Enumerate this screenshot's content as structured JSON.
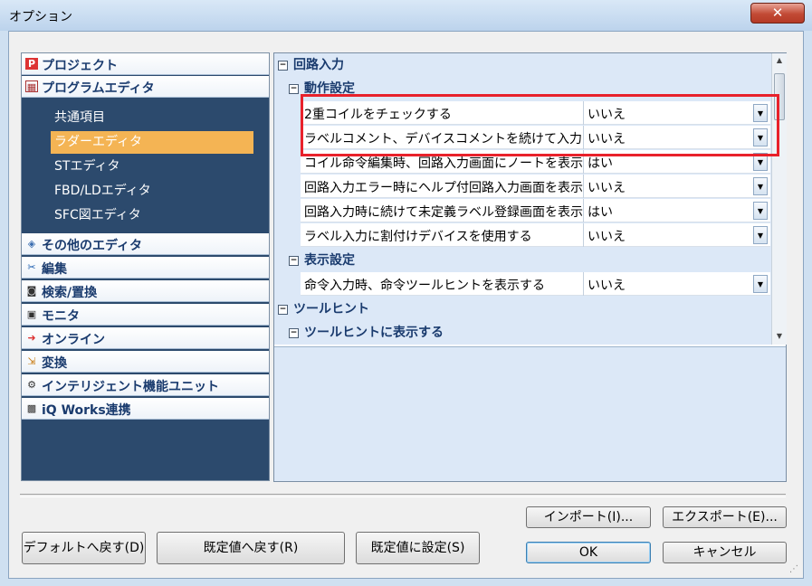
{
  "window": {
    "title": "オプション",
    "close": "✕"
  },
  "tree": {
    "categories_top": [
      {
        "label": "プロジェクト",
        "icon": "project-icon"
      },
      {
        "label": "プログラムエディタ",
        "icon": "program-editor-icon"
      }
    ],
    "sub_items": [
      {
        "label": "共通項目",
        "selected": false
      },
      {
        "label": "ラダーエディタ",
        "selected": true
      },
      {
        "label": "STエディタ",
        "selected": false
      },
      {
        "label": "FBD/LDエディタ",
        "selected": false
      },
      {
        "label": "SFC図エディタ",
        "selected": false
      }
    ],
    "categories_bottom": [
      {
        "label": "その他のエディタ",
        "icon": "other-editor-icon"
      },
      {
        "label": "編集",
        "icon": "scissors-icon"
      },
      {
        "label": "検索/置換",
        "icon": "binoculars-icon"
      },
      {
        "label": "モニタ",
        "icon": "monitor-icon"
      },
      {
        "label": "オンライン",
        "icon": "online-icon"
      },
      {
        "label": "変換",
        "icon": "convert-icon"
      },
      {
        "label": "インテリジェント機能ユニット",
        "icon": "intelligent-unit-icon"
      },
      {
        "label": "iQ Works連携",
        "icon": "iq-works-icon"
      }
    ]
  },
  "grid": {
    "sections": {
      "circuit_input": "回路入力",
      "operation_settings": "動作設定",
      "display_settings": "表示設定",
      "tooltip": "ツールヒント",
      "tooltip_display": "ツールヒントに表示する"
    },
    "operation_rows": [
      {
        "name": "2重コイルをチェックする",
        "value": "いいえ"
      },
      {
        "name": "ラベルコメント、デバイスコメントを続けて入力する",
        "value": "いいえ"
      },
      {
        "name": "コイル命令編集時、回路入力画面にノートを表示する",
        "value": "はい"
      },
      {
        "name": "回路入力エラー時にヘルプ付回路入力画面を表示する",
        "value": "いいえ"
      },
      {
        "name": "回路入力時に続けて未定義ラベル登録画面を表示する",
        "value": "はい"
      },
      {
        "name": "ラベル入力に割付けデバイスを使用する",
        "value": "いいえ"
      }
    ],
    "display_rows": [
      {
        "name": "命令入力時、命令ツールヒントを表示する",
        "value": "いいえ"
      }
    ]
  },
  "buttons": {
    "import": "インポート(I)...",
    "export": "エクスポート(E)...",
    "ok": "OK",
    "cancel": "キャンセル",
    "reset_default": "デフォルトへ戻す(D)",
    "reset_initial": "既定値へ戻す(R)",
    "set_initial": "既定値に設定(S)"
  }
}
